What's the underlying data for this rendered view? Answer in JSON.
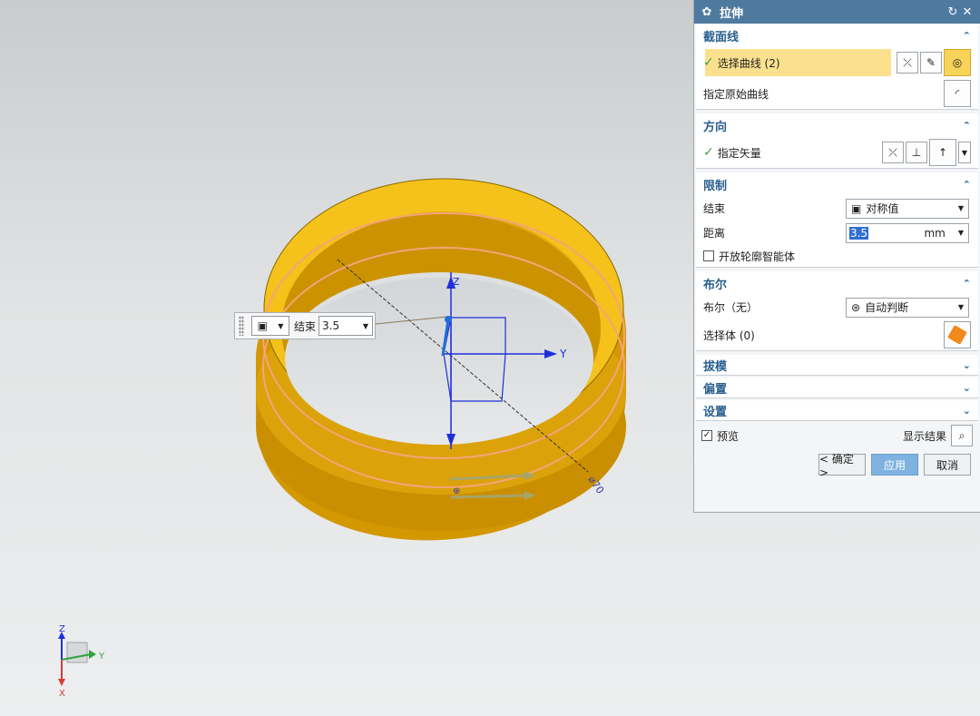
{
  "dialog": {
    "title": "拉伸",
    "section_curve": {
      "header": "截面线",
      "select_curve_label": "选择曲线 (2)",
      "specify_original_curve": "指定原始曲线"
    },
    "section_direction": {
      "header": "方向",
      "specify_vector": "指定矢量"
    },
    "section_limits": {
      "header": "限制",
      "end_label": "结束",
      "end_value": "对称值",
      "distance_label": "距离",
      "distance_value": "3.5",
      "distance_unit": "mm",
      "open_profile_label": "开放轮廓智能体"
    },
    "section_boolean": {
      "header": "布尔",
      "boolean_label": "布尔（无）",
      "boolean_value": "自动判断",
      "select_body_label": "选择体 (0)"
    },
    "section_draft": {
      "header": "拔模"
    },
    "section_offset": {
      "header": "偏置"
    },
    "section_settings": {
      "header": "设置"
    },
    "preview_label": "预览",
    "show_result_label": "显示结果",
    "ok_label": "< 确定 >",
    "apply_label": "应用",
    "cancel_label": "取消"
  },
  "mini_toolbar": {
    "end_label": "结束",
    "end_value": "3.5"
  },
  "axes": {
    "dynamic_y": "Y",
    "dynamic_z": "Z",
    "triad_x": "X",
    "triad_y": "Y",
    "triad_z": "Z"
  },
  "colors": {
    "title_bar": "#4f7aa0",
    "ring_top": "#f5c21b",
    "ring_side": "#d39700",
    "highlight": "#fbe18d",
    "primary_button": "#7fb2e0"
  }
}
